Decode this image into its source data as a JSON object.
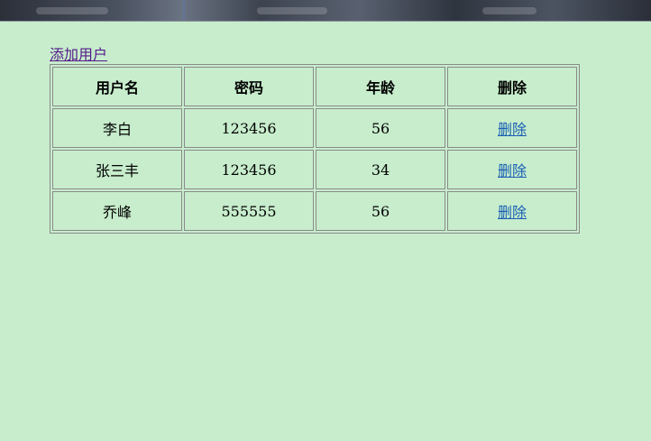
{
  "toolbar": {
    "add_user_label": "添加用户"
  },
  "table": {
    "headers": [
      "用户名",
      "密码",
      "年龄",
      "删除"
    ],
    "rows": [
      {
        "username": "李白",
        "password": "123456",
        "age": "56",
        "delete": "删除"
      },
      {
        "username": "张三丰",
        "password": "123456",
        "age": "34",
        "delete": "删除"
      },
      {
        "username": "乔峰",
        "password": "555555",
        "age": "56",
        "delete": "删除"
      }
    ]
  },
  "colors": {
    "background": "#c7edcc",
    "visited_link": "#551a8b",
    "link": "#1a5fb4",
    "border": "#8a8a8a"
  }
}
